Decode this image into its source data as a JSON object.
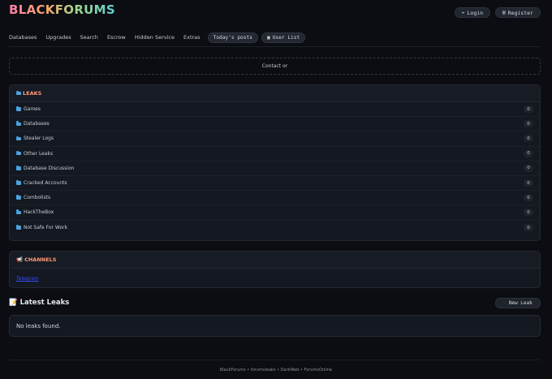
{
  "header": {
    "logo": "BLACKFORUMS",
    "login_label": "Login",
    "register_label": "Register",
    "login_icon": "pencil-icon",
    "register_icon": "clipboard-icon"
  },
  "nav": {
    "items": [
      "Databases",
      "Upgrades",
      "Search",
      "Escrow",
      "Hidden Service",
      "Extras"
    ],
    "todays_posts": "Today's posts",
    "user_list": "User List"
  },
  "contact": {
    "text": "Contact or"
  },
  "leaks": {
    "title": "LEAKS",
    "rows": [
      {
        "name": "Games",
        "count": "0"
      },
      {
        "name": "Databases",
        "count": "0"
      },
      {
        "name": "Stealer Logs",
        "count": "0"
      },
      {
        "name": "Other Leaks",
        "count": "0"
      },
      {
        "name": "Database Discussion",
        "count": "0"
      },
      {
        "name": "Cracked Accounts",
        "count": "0"
      },
      {
        "name": "Combolists",
        "count": "0"
      },
      {
        "name": "HackTheBox",
        "count": "0"
      },
      {
        "name": "Not Safe For Work",
        "count": "0"
      }
    ]
  },
  "channels": {
    "title": "CHANNELS",
    "link": "Telegram"
  },
  "latest": {
    "title": "Latest Leaks",
    "new_leak_label": "New Leak",
    "empty_text": "No leaks found."
  },
  "footer": {
    "text": "BlackForums • forumsleaks • DarkWeb • ForumsOnline"
  },
  "colors": {
    "background": "#0b0d12",
    "panel": "#141820",
    "section_title": "#ff9b7a",
    "folder": "#4aa3df",
    "link": "#3b4cff"
  }
}
